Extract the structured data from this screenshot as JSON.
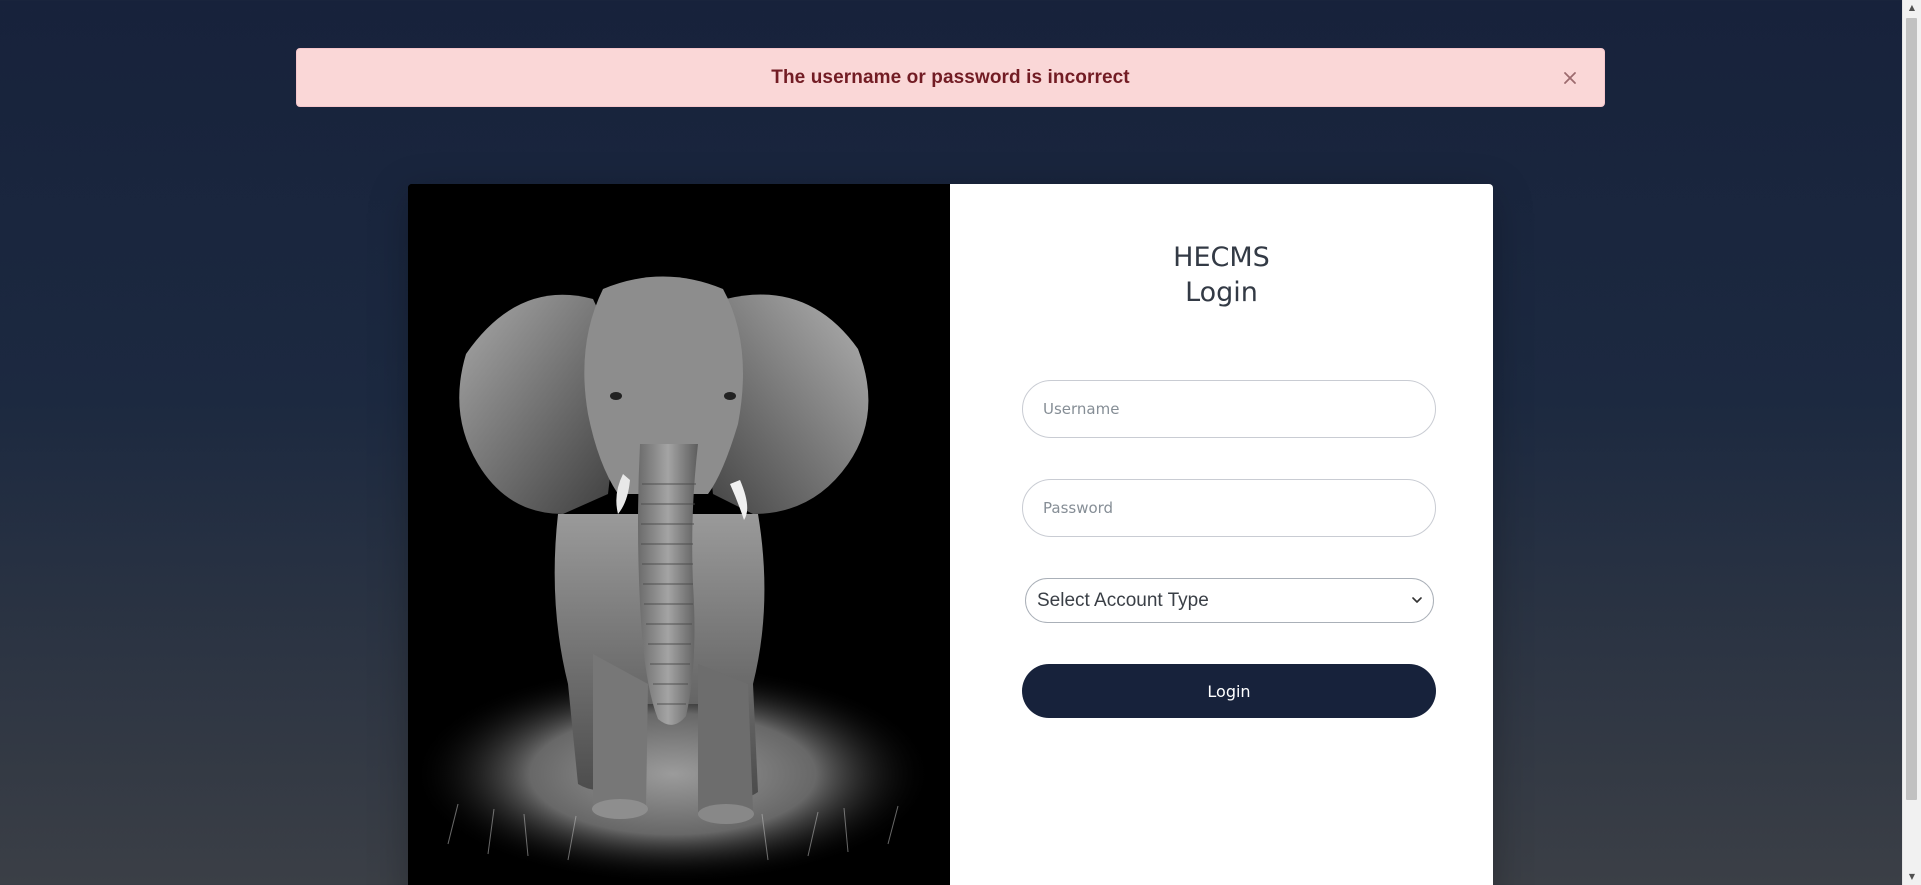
{
  "alert": {
    "message": "The username or password is incorrect",
    "close_icon": "close-icon"
  },
  "image": {
    "subject": "elephant-photo",
    "alt": ""
  },
  "login": {
    "title_line1": "HECMS",
    "title_line2": "Login",
    "username_placeholder": "Username",
    "password_placeholder": "Password",
    "account_type_selected": "Select Account Type",
    "submit_label": "Login"
  },
  "colors": {
    "background_top": "#17223b",
    "background_bottom": "#3b3f46",
    "alert_bg": "#fad7d7",
    "alert_text": "#721c24",
    "button_bg": "#17223b",
    "button_text": "#ffffff"
  }
}
